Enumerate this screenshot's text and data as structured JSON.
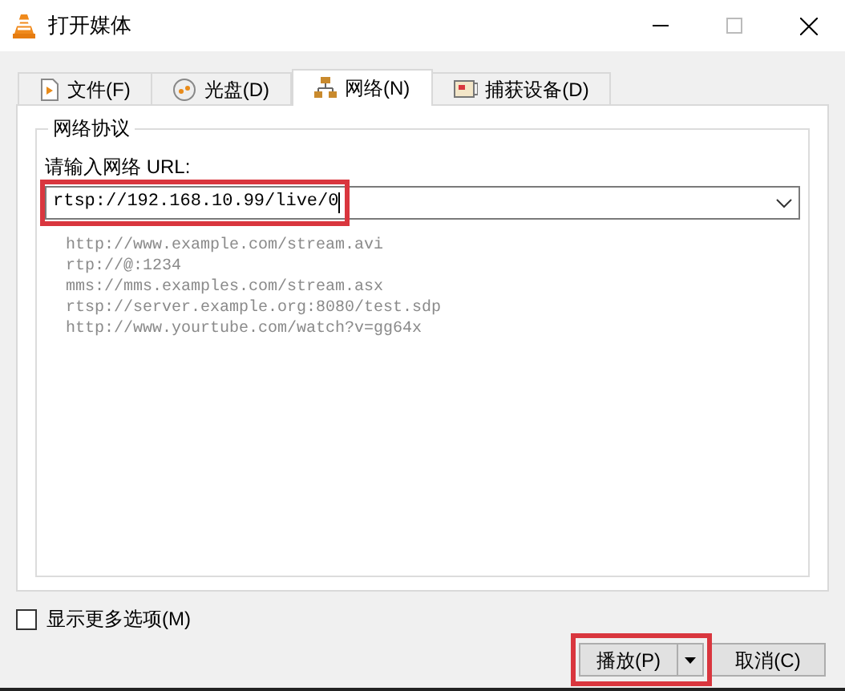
{
  "window": {
    "title": "打开媒体"
  },
  "tabs": [
    {
      "label": "文件(F)",
      "kind": "file",
      "selected": false
    },
    {
      "label": "光盘(D)",
      "kind": "disc",
      "selected": false
    },
    {
      "label": "网络(N)",
      "kind": "network",
      "selected": true
    },
    {
      "label": "捕获设备(D)",
      "kind": "capture",
      "selected": false
    }
  ],
  "group": {
    "title": "网络协议",
    "url_label": "请输入网络 URL:",
    "url_value": "rtsp://192.168.10.99/live/0",
    "url_highlighted": true,
    "examples": [
      "http://www.example.com/stream.avi",
      "rtp://@:1234",
      "mms://mms.examples.com/stream.asx",
      "rtsp://server.example.org:8080/test.sdp",
      "http://www.yourtube.com/watch?v=gg64x"
    ]
  },
  "more_options": {
    "label": "显示更多选项(M)",
    "checked": false
  },
  "buttons": {
    "play": "播放(P)",
    "play_highlighted": true,
    "cancel": "取消(C)"
  }
}
